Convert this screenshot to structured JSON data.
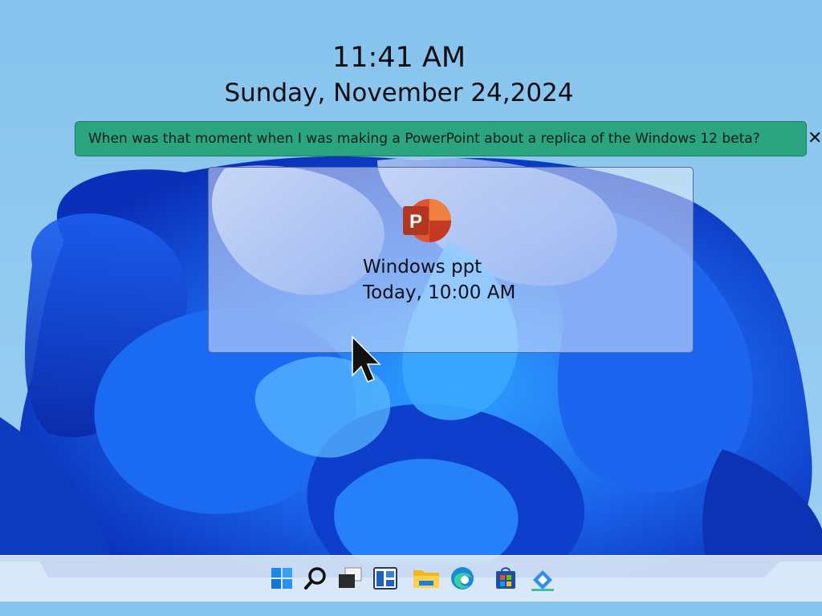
{
  "clock": {
    "time": "11:41 AM",
    "date": "Sunday, November 24,2024"
  },
  "search": {
    "query": "When was that moment when I was making a PowerPoint about a replica of the Windows 12 beta?",
    "close_glyph": "✕"
  },
  "result": {
    "app_icon": "powerpoint-icon",
    "icon_letter": "P",
    "title": "Windows ppt",
    "timestamp": "Today, 10:00 AM"
  },
  "taskbar": {
    "icons": [
      "windows-start-icon",
      "search-icon",
      "task-view-icon",
      "widgets-icon",
      "file-explorer-icon",
      "edge-browser-icon",
      "microsoft-store-icon",
      "recall-icon"
    ]
  },
  "colors": {
    "search_bar_bg": "#2ba57f",
    "wallpaper_sky": "#88c4ee",
    "wallpaper_bloom": "#1656e0",
    "powerpoint_orange": "#e1542f"
  }
}
